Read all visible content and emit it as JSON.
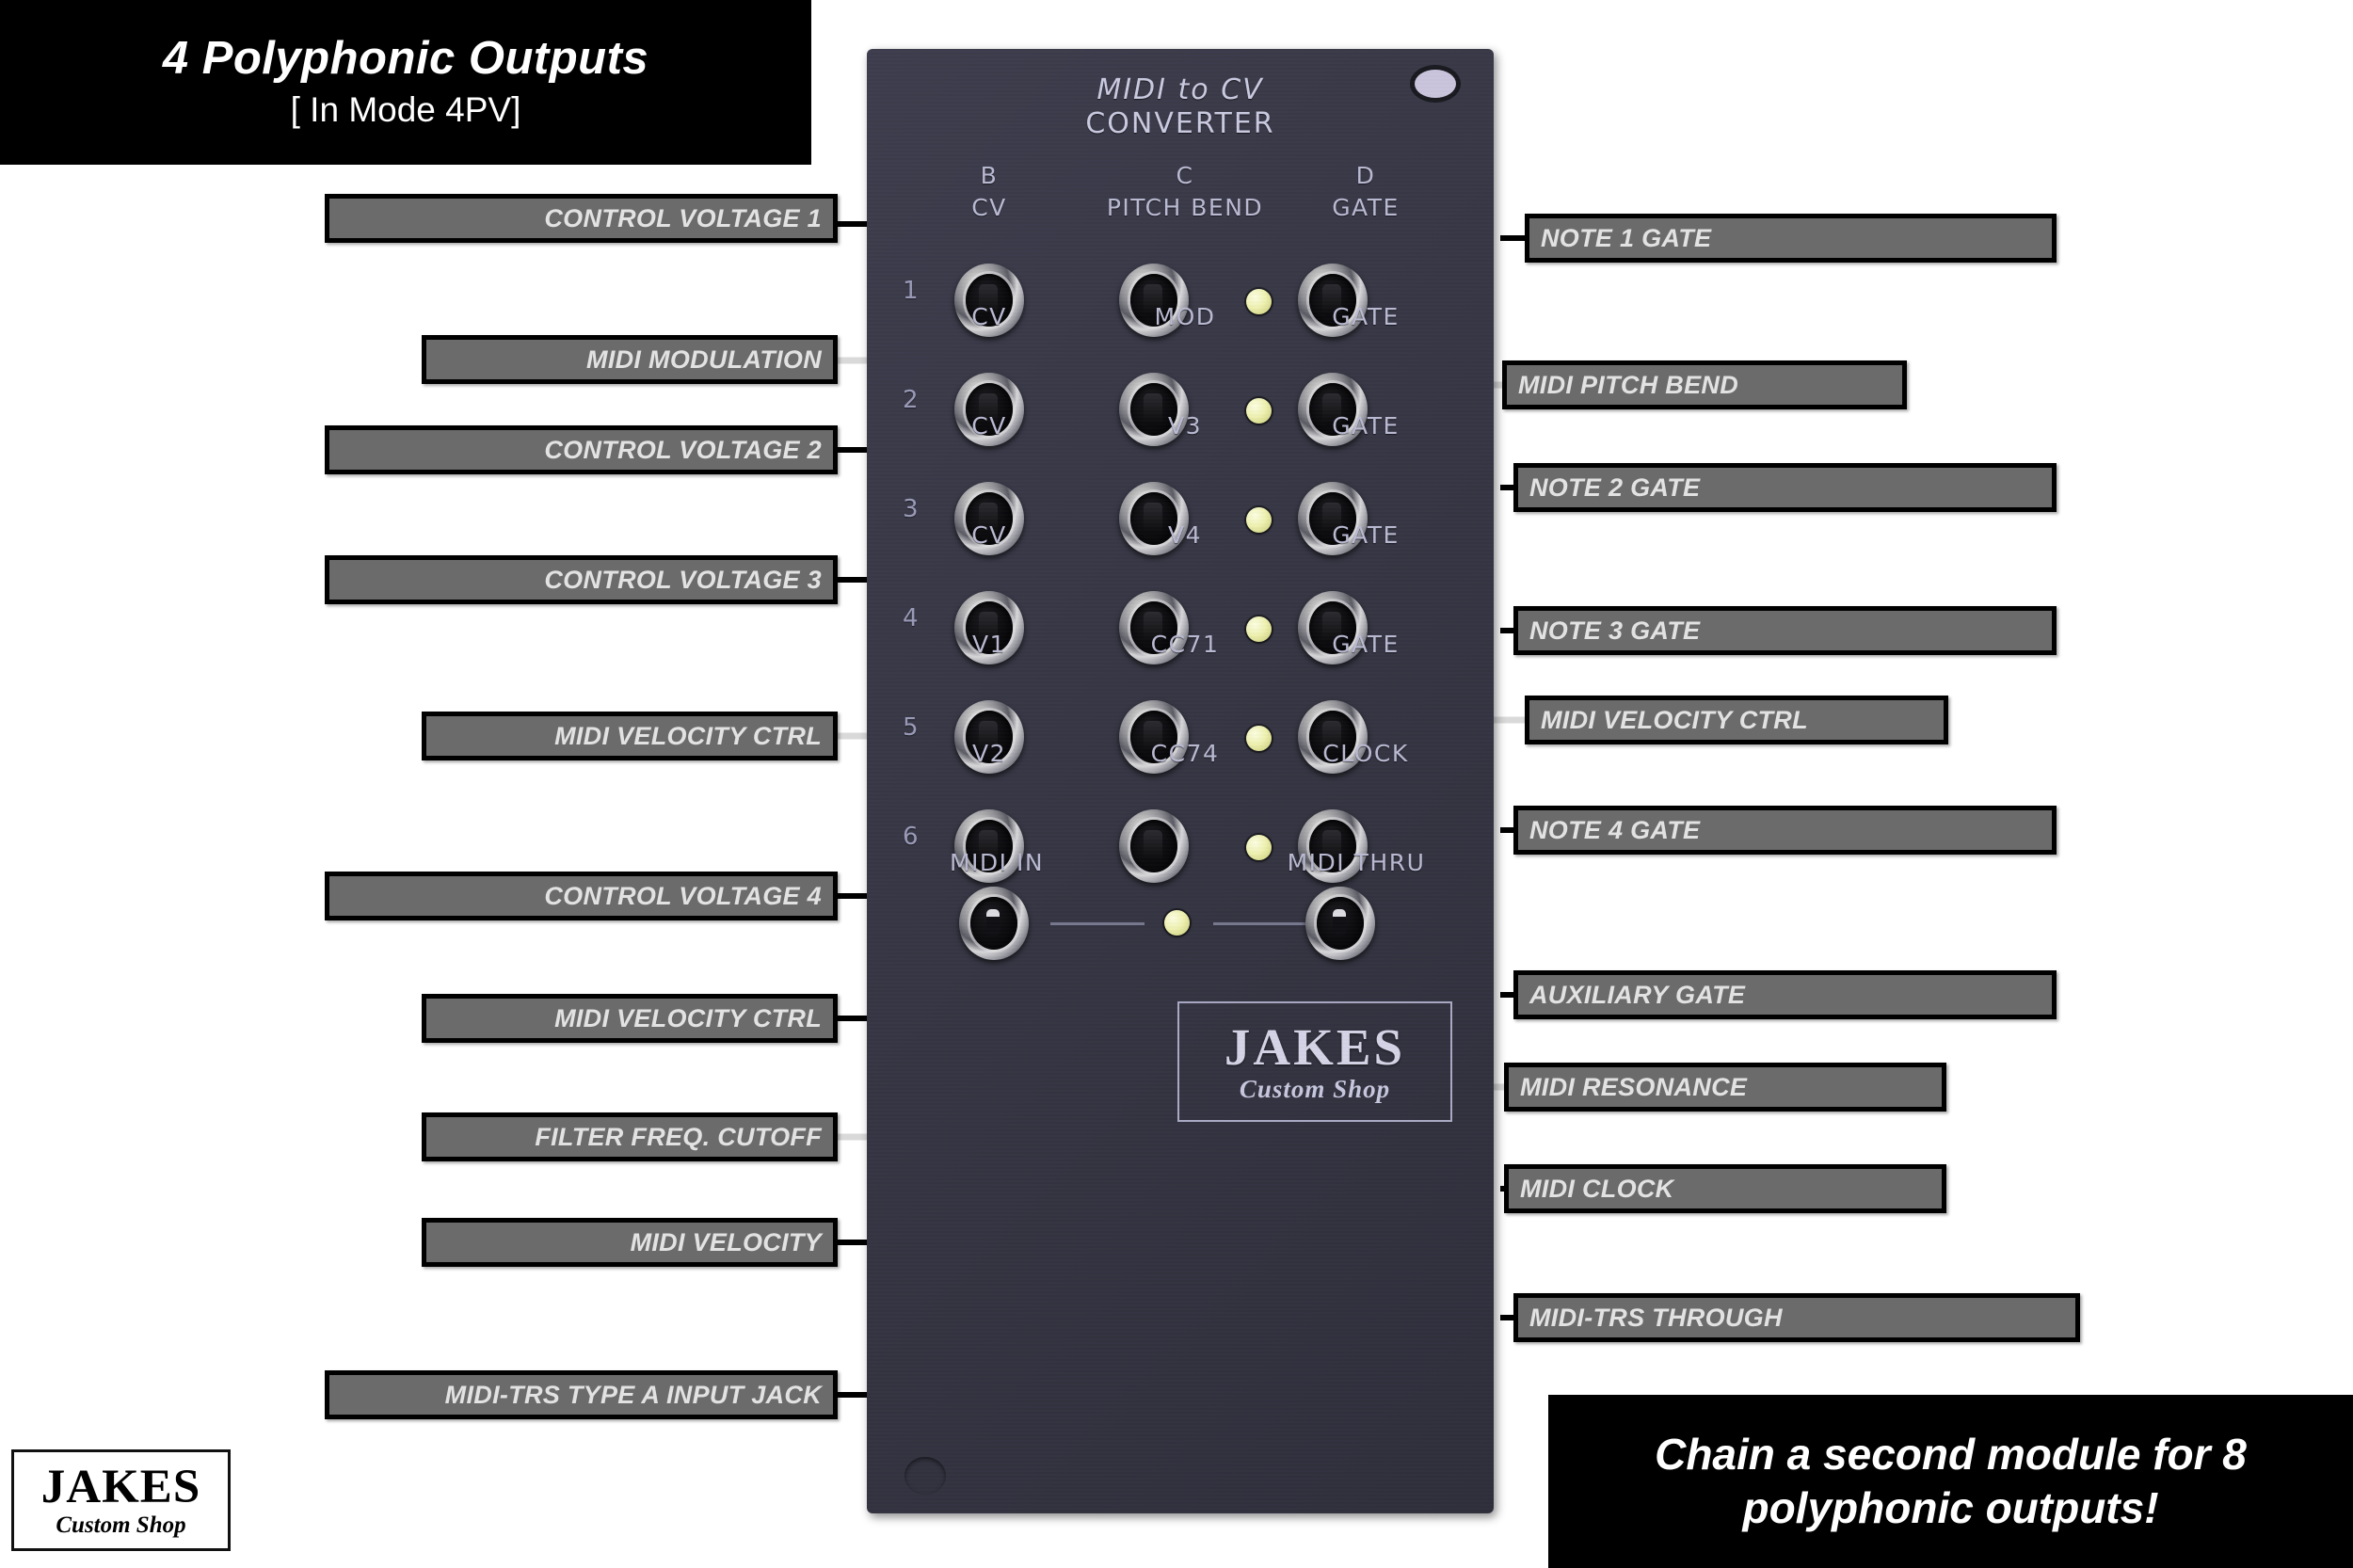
{
  "banners": {
    "top": {
      "line1": "4 Polyphonic Outputs",
      "line2": "[ In Mode 4PV]"
    },
    "bottom": {
      "line1": "Chain a second module for 8",
      "line2": "polyphonic outputs!"
    }
  },
  "brand_logo": {
    "name": "JAKES",
    "tagline": "Custom Shop"
  },
  "panel": {
    "title_line1": "MIDI to CV",
    "title_line2": "CONVERTER",
    "brand": {
      "name": "JAKES",
      "tagline": "Custom Shop"
    },
    "column_letters": {
      "b": "B",
      "c": "C",
      "d": "D"
    },
    "rows": [
      {
        "num": "1",
        "left": "CV",
        "mid": "PITCH BEND",
        "right": "GATE"
      },
      {
        "num": "2",
        "left": "CV",
        "mid": "MOD",
        "right": "GATE"
      },
      {
        "num": "3",
        "left": "CV",
        "mid": "V3",
        "right": "GATE"
      },
      {
        "num": "4",
        "left": "CV",
        "mid": "V4",
        "right": "GATE"
      },
      {
        "num": "5",
        "left": "V1",
        "mid": "CC71",
        "right": "GATE"
      },
      {
        "num": "6",
        "left": "V2",
        "mid": "CC74",
        "right": "CLOCK"
      }
    ],
    "midi_row": {
      "in": "MIDI IN",
      "thru": "MIDI THRU"
    }
  },
  "callouts_left": [
    {
      "text": "CONTROL VOLTAGE 1"
    },
    {
      "text": "MIDI MODULATION"
    },
    {
      "text": "CONTROL VOLTAGE 2"
    },
    {
      "text": "CONTROL VOLTAGE 3"
    },
    {
      "text": "MIDI VELOCITY CTRL"
    },
    {
      "text": "CONTROL VOLTAGE 4"
    },
    {
      "text": "MIDI VELOCITY CTRL"
    },
    {
      "text": "FILTER FREQ. CUTOFF"
    },
    {
      "text": "MIDI VELOCITY"
    },
    {
      "text": "MIDI-TRS TYPE A INPUT JACK"
    }
  ],
  "callouts_right": [
    {
      "text": "NOTE 1 GATE"
    },
    {
      "text": "MIDI PITCH BEND"
    },
    {
      "text": "NOTE 2 GATE"
    },
    {
      "text": "NOTE 3 GATE"
    },
    {
      "text": "MIDI VELOCITY CTRL"
    },
    {
      "text": "NOTE 4 GATE"
    },
    {
      "text": "AUXILIARY GATE"
    },
    {
      "text": "MIDI RESONANCE"
    },
    {
      "text": "MIDI CLOCK"
    },
    {
      "text": "MIDI-TRS THROUGH"
    }
  ],
  "colors": {
    "panel": "#3a3a4a",
    "callout_fill": "#6b6b6b",
    "callout_text": "#e2e2e2",
    "banner_bg": "#000000",
    "led": "#eef1b0",
    "panel_text": "#b9b9d2",
    "arrow": "#d9d9d9"
  }
}
